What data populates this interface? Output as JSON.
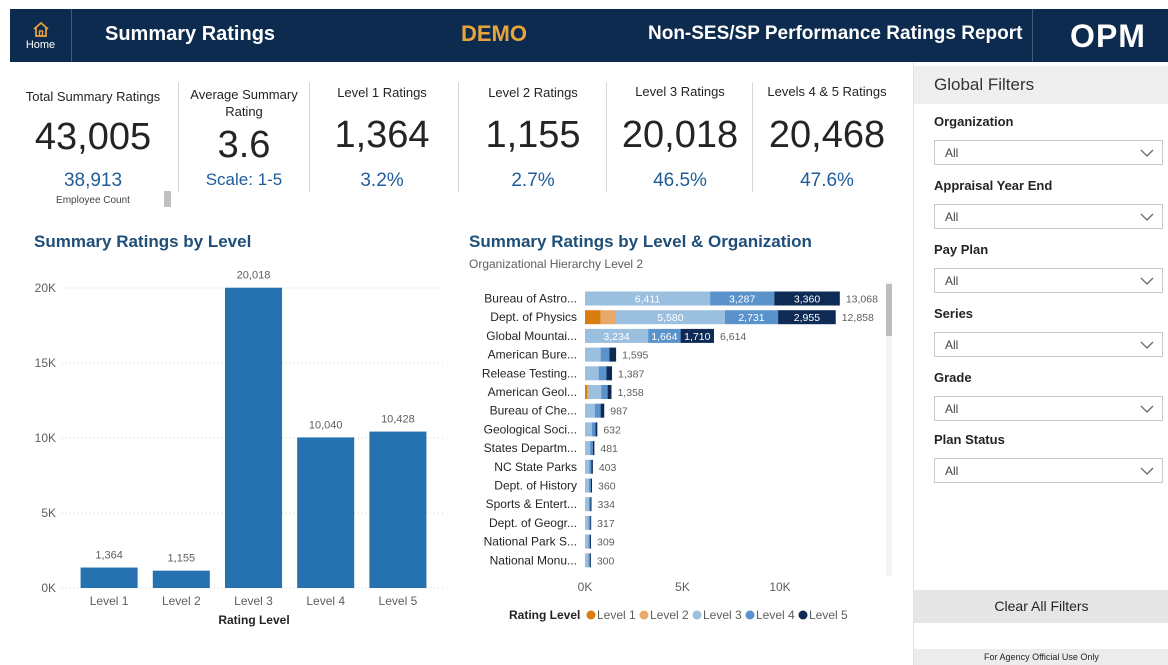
{
  "header": {
    "home_label": "Home",
    "title": "Summary Ratings",
    "demo": "DEMO",
    "report_title": "Non-SES/SP Performance Ratings Report",
    "logo_text": "OPM"
  },
  "kpis": {
    "total": {
      "label": "Total Summary Ratings",
      "value": "43,005",
      "sub": "38,913",
      "note": "Employee Count"
    },
    "average": {
      "label": "Average Summary Rating",
      "value": "3.6",
      "sub": "Scale: 1-5"
    },
    "level1": {
      "label": "Level 1 Ratings",
      "value": "1,364",
      "sub": "3.2%"
    },
    "level2": {
      "label": "Level 2 Ratings",
      "value": "1,155",
      "sub": "2.7%"
    },
    "level3": {
      "label": "Level 3 Ratings",
      "value": "20,018",
      "sub": "46.5%"
    },
    "level45": {
      "label": "Levels 4 & 5 Ratings",
      "value": "20,468",
      "sub": "47.6%"
    }
  },
  "left_chart": {
    "title": "Summary Ratings by Level"
  },
  "right_chart": {
    "title": "Summary Ratings by Level & Organization",
    "subtitle": "Organizational Hierarchy Level 2"
  },
  "chart_data": [
    {
      "type": "bar",
      "title": "Summary Ratings by Level",
      "categories": [
        "Level 1",
        "Level 2",
        "Level 3",
        "Level 4",
        "Level 5"
      ],
      "values": [
        1364,
        1155,
        20018,
        10040,
        10428
      ],
      "value_labels": [
        "1,364",
        "1,155",
        "20,018",
        "10,040",
        "10,428"
      ],
      "xlabel": "Rating Level",
      "ylabel": "",
      "ylim": [
        0,
        21000
      ],
      "yticks": [
        0,
        5000,
        10000,
        15000,
        20000
      ],
      "ytick_labels": [
        "0K",
        "5K",
        "10K",
        "15K",
        "20K"
      ],
      "grid": true,
      "color": "#2671b0"
    },
    {
      "type": "bar",
      "orientation": "horizontal",
      "stacked": true,
      "title": "Summary Ratings by Level & Organization",
      "categories": [
        "Bureau of Astro...",
        "Dept. of Physics",
        "Global Mountai...",
        "American Bure...",
        "Release Testing...",
        "American Geol...",
        "Bureau of Che...",
        "Geological Soci...",
        "States Departm...",
        "NC State Parks",
        "Dept. of History",
        "Sports & Entert...",
        "Dept. of Geogr...",
        "National Park S...",
        "National Monu..."
      ],
      "totals": [
        13068,
        12858,
        6614,
        1595,
        1387,
        1358,
        987,
        632,
        481,
        403,
        360,
        334,
        317,
        309,
        300
      ],
      "total_labels": [
        "13,068",
        "12,858",
        "6,614",
        "1,595",
        "1,387",
        "1,358",
        "987",
        "632",
        "481",
        "403",
        "360",
        "334",
        "317",
        "309",
        "300"
      ],
      "series": [
        {
          "name": "Level 1",
          "color": "#d97d0f",
          "values": [
            0,
            800,
            0,
            0,
            0,
            120,
            0,
            0,
            0,
            0,
            0,
            0,
            0,
            0,
            0
          ]
        },
        {
          "name": "Level 2",
          "color": "#e8a96a",
          "values": [
            0,
            792,
            0,
            0,
            0,
            60,
            0,
            0,
            0,
            0,
            0,
            0,
            0,
            0,
            0
          ]
        },
        {
          "name": "Level 3",
          "color": "#9bbfdf",
          "values": [
            6411,
            5580,
            3234,
            800,
            700,
            650,
            500,
            360,
            260,
            220,
            200,
            190,
            180,
            170,
            170
          ]
        },
        {
          "name": "Level 4",
          "color": "#5a93cc",
          "values": [
            3287,
            2731,
            1664,
            450,
            400,
            330,
            300,
            180,
            140,
            110,
            100,
            90,
            90,
            90,
            80
          ]
        },
        {
          "name": "Level 5",
          "color": "#0d2b55",
          "values": [
            3360,
            2955,
            1710,
            345,
            287,
            198,
            187,
            92,
            81,
            73,
            60,
            54,
            47,
            49,
            50
          ]
        }
      ],
      "segment_labels": [
        [
          "",
          "",
          "6,411",
          "3,287",
          "3,360"
        ],
        [
          "",
          "",
          "5,580",
          "2,731",
          "2,955"
        ],
        [
          "",
          "",
          "3,234",
          "1,664",
          "1,710"
        ]
      ],
      "xticks": [
        0,
        5000,
        10000
      ],
      "xtick_labels": [
        "0K",
        "5K",
        "10K"
      ],
      "xlim": [
        0,
        13300
      ],
      "legend_title": "Rating Level",
      "legend": [
        "Level 1",
        "Level 2",
        "Level 3",
        "Level 4",
        "Level 5"
      ]
    }
  ],
  "filters": {
    "title": "Global Filters",
    "items": [
      {
        "label": "Organization",
        "value": "All"
      },
      {
        "label": "Appraisal Year End",
        "value": "All"
      },
      {
        "label": "Pay Plan",
        "value": "All"
      },
      {
        "label": "Series",
        "value": "All"
      },
      {
        "label": "Grade",
        "value": "All"
      },
      {
        "label": "Plan Status",
        "value": "All"
      }
    ],
    "clear_label": "Clear All Filters",
    "footer": "For Agency Official Use Only"
  }
}
